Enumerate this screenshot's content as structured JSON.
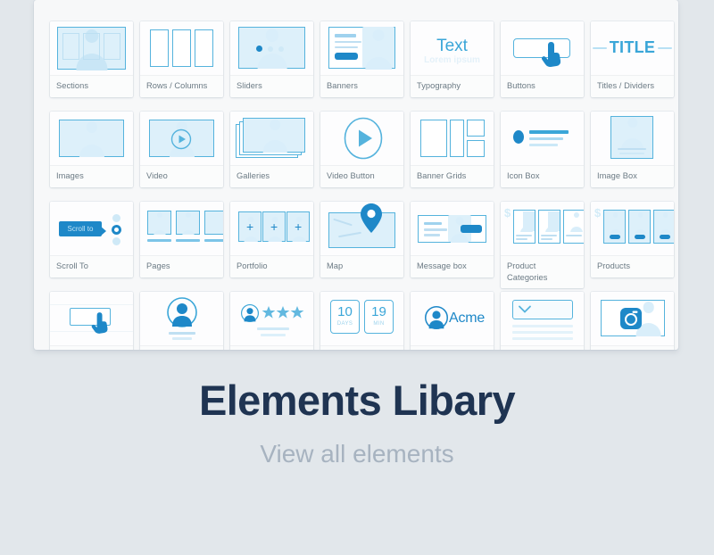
{
  "footer": {
    "title": "Elements Libary",
    "subtitle": "View all elements"
  },
  "theme": {
    "page_background": "#e2e7eb",
    "panel_background": "#f7f8f9",
    "card_background": "#ffffff",
    "accent_blue": "#1e88c8",
    "wire_blue": "#55b3dd",
    "wire_fill": "#ddf0fa",
    "title_color": "#1f3452",
    "subtitle_color": "#a7b3c0",
    "label_color": "#6b7a84"
  },
  "panel": {
    "rows": [
      {
        "cards": [
          {
            "label": "Sections",
            "icon": "sections-thumb"
          },
          {
            "label": "Rows / Columns",
            "icon": "rows-columns-thumb"
          },
          {
            "label": "Sliders",
            "icon": "sliders-thumb"
          },
          {
            "label": "Banners",
            "icon": "banners-thumb"
          },
          {
            "label": "Typography",
            "icon": "typography-thumb"
          },
          {
            "label": "Buttons",
            "icon": "buttons-thumb"
          },
          {
            "label": "Titles / Dividers",
            "icon": "titles-dividers-thumb"
          }
        ]
      },
      {
        "cards": [
          {
            "label": "Images",
            "icon": "images-thumb"
          },
          {
            "label": "Video",
            "icon": "video-thumb"
          },
          {
            "label": "Galleries",
            "icon": "galleries-thumb"
          },
          {
            "label": "Video Button",
            "icon": "video-button-thumb"
          },
          {
            "label": "Banner Grids",
            "icon": "banner-grids-thumb"
          },
          {
            "label": "Icon Box",
            "icon": "icon-box-thumb"
          },
          {
            "label": "Image Box",
            "icon": "image-box-thumb"
          }
        ]
      },
      {
        "cards": [
          {
            "label": "Scroll To",
            "icon": "scroll-to-thumb"
          },
          {
            "label": "Pages",
            "icon": "pages-thumb"
          },
          {
            "label": "Portfolio",
            "icon": "portfolio-thumb"
          },
          {
            "label": "Map",
            "icon": "map-thumb"
          },
          {
            "label": "Message box",
            "icon": "message-box-thumb"
          },
          {
            "label": "Product Categories",
            "icon": "product-categories-thumb"
          },
          {
            "label": "Products",
            "icon": "products-thumb"
          }
        ]
      },
      {
        "cards": [
          {
            "label": "",
            "icon": "click-button-thumb"
          },
          {
            "label": "",
            "icon": "person-circle-thumb"
          },
          {
            "label": "",
            "icon": "testimonial-stars-thumb"
          },
          {
            "label": "",
            "icon": "countdown-thumb"
          },
          {
            "label": "",
            "icon": "acme-logo-thumb"
          },
          {
            "label": "",
            "icon": "accordion-thumb"
          },
          {
            "label": "",
            "icon": "instagram-thumb"
          }
        ]
      }
    ]
  },
  "thumb_text": {
    "typography_main": "Text",
    "typography_sub": "Lorem ipsum",
    "titles_main": "TITLE",
    "scroll_to": "Scroll to",
    "countdown_days_value": "10",
    "countdown_days_unit": "DAYS",
    "countdown_min_value": "19",
    "countdown_min_unit": "MIN",
    "acme": "Acme",
    "product_price": "$"
  }
}
